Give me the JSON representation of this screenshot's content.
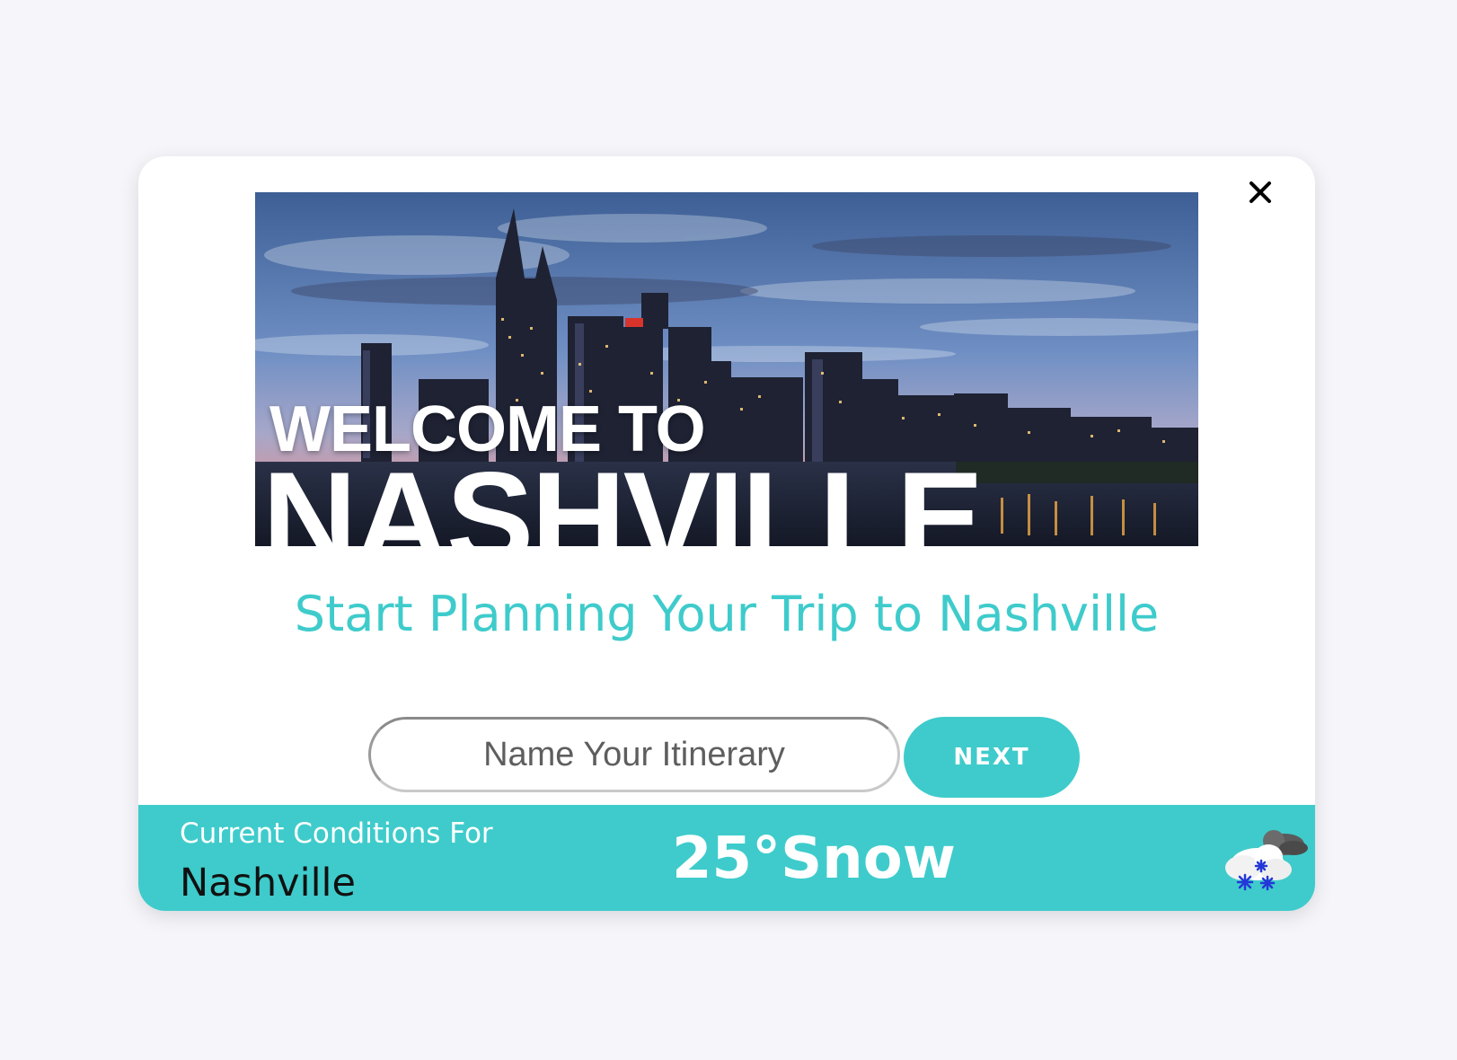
{
  "modal": {
    "close_label": "X",
    "hero": {
      "line1": "WELCOME TO",
      "line2": "NASHVILLE"
    },
    "headline": "Start Planning Your Trip to Nashville",
    "itinerary_input": {
      "value": "",
      "placeholder": "Name Your Itinerary"
    },
    "next_label": "NEXT"
  },
  "weather": {
    "label": "Current Conditions For",
    "city": "Nashville",
    "summary": "25°Snow",
    "icon": "snow-cloud-icon"
  },
  "colors": {
    "accent": "#3fcbcb",
    "background": "#f5f5fa",
    "card": "#ffffff"
  }
}
